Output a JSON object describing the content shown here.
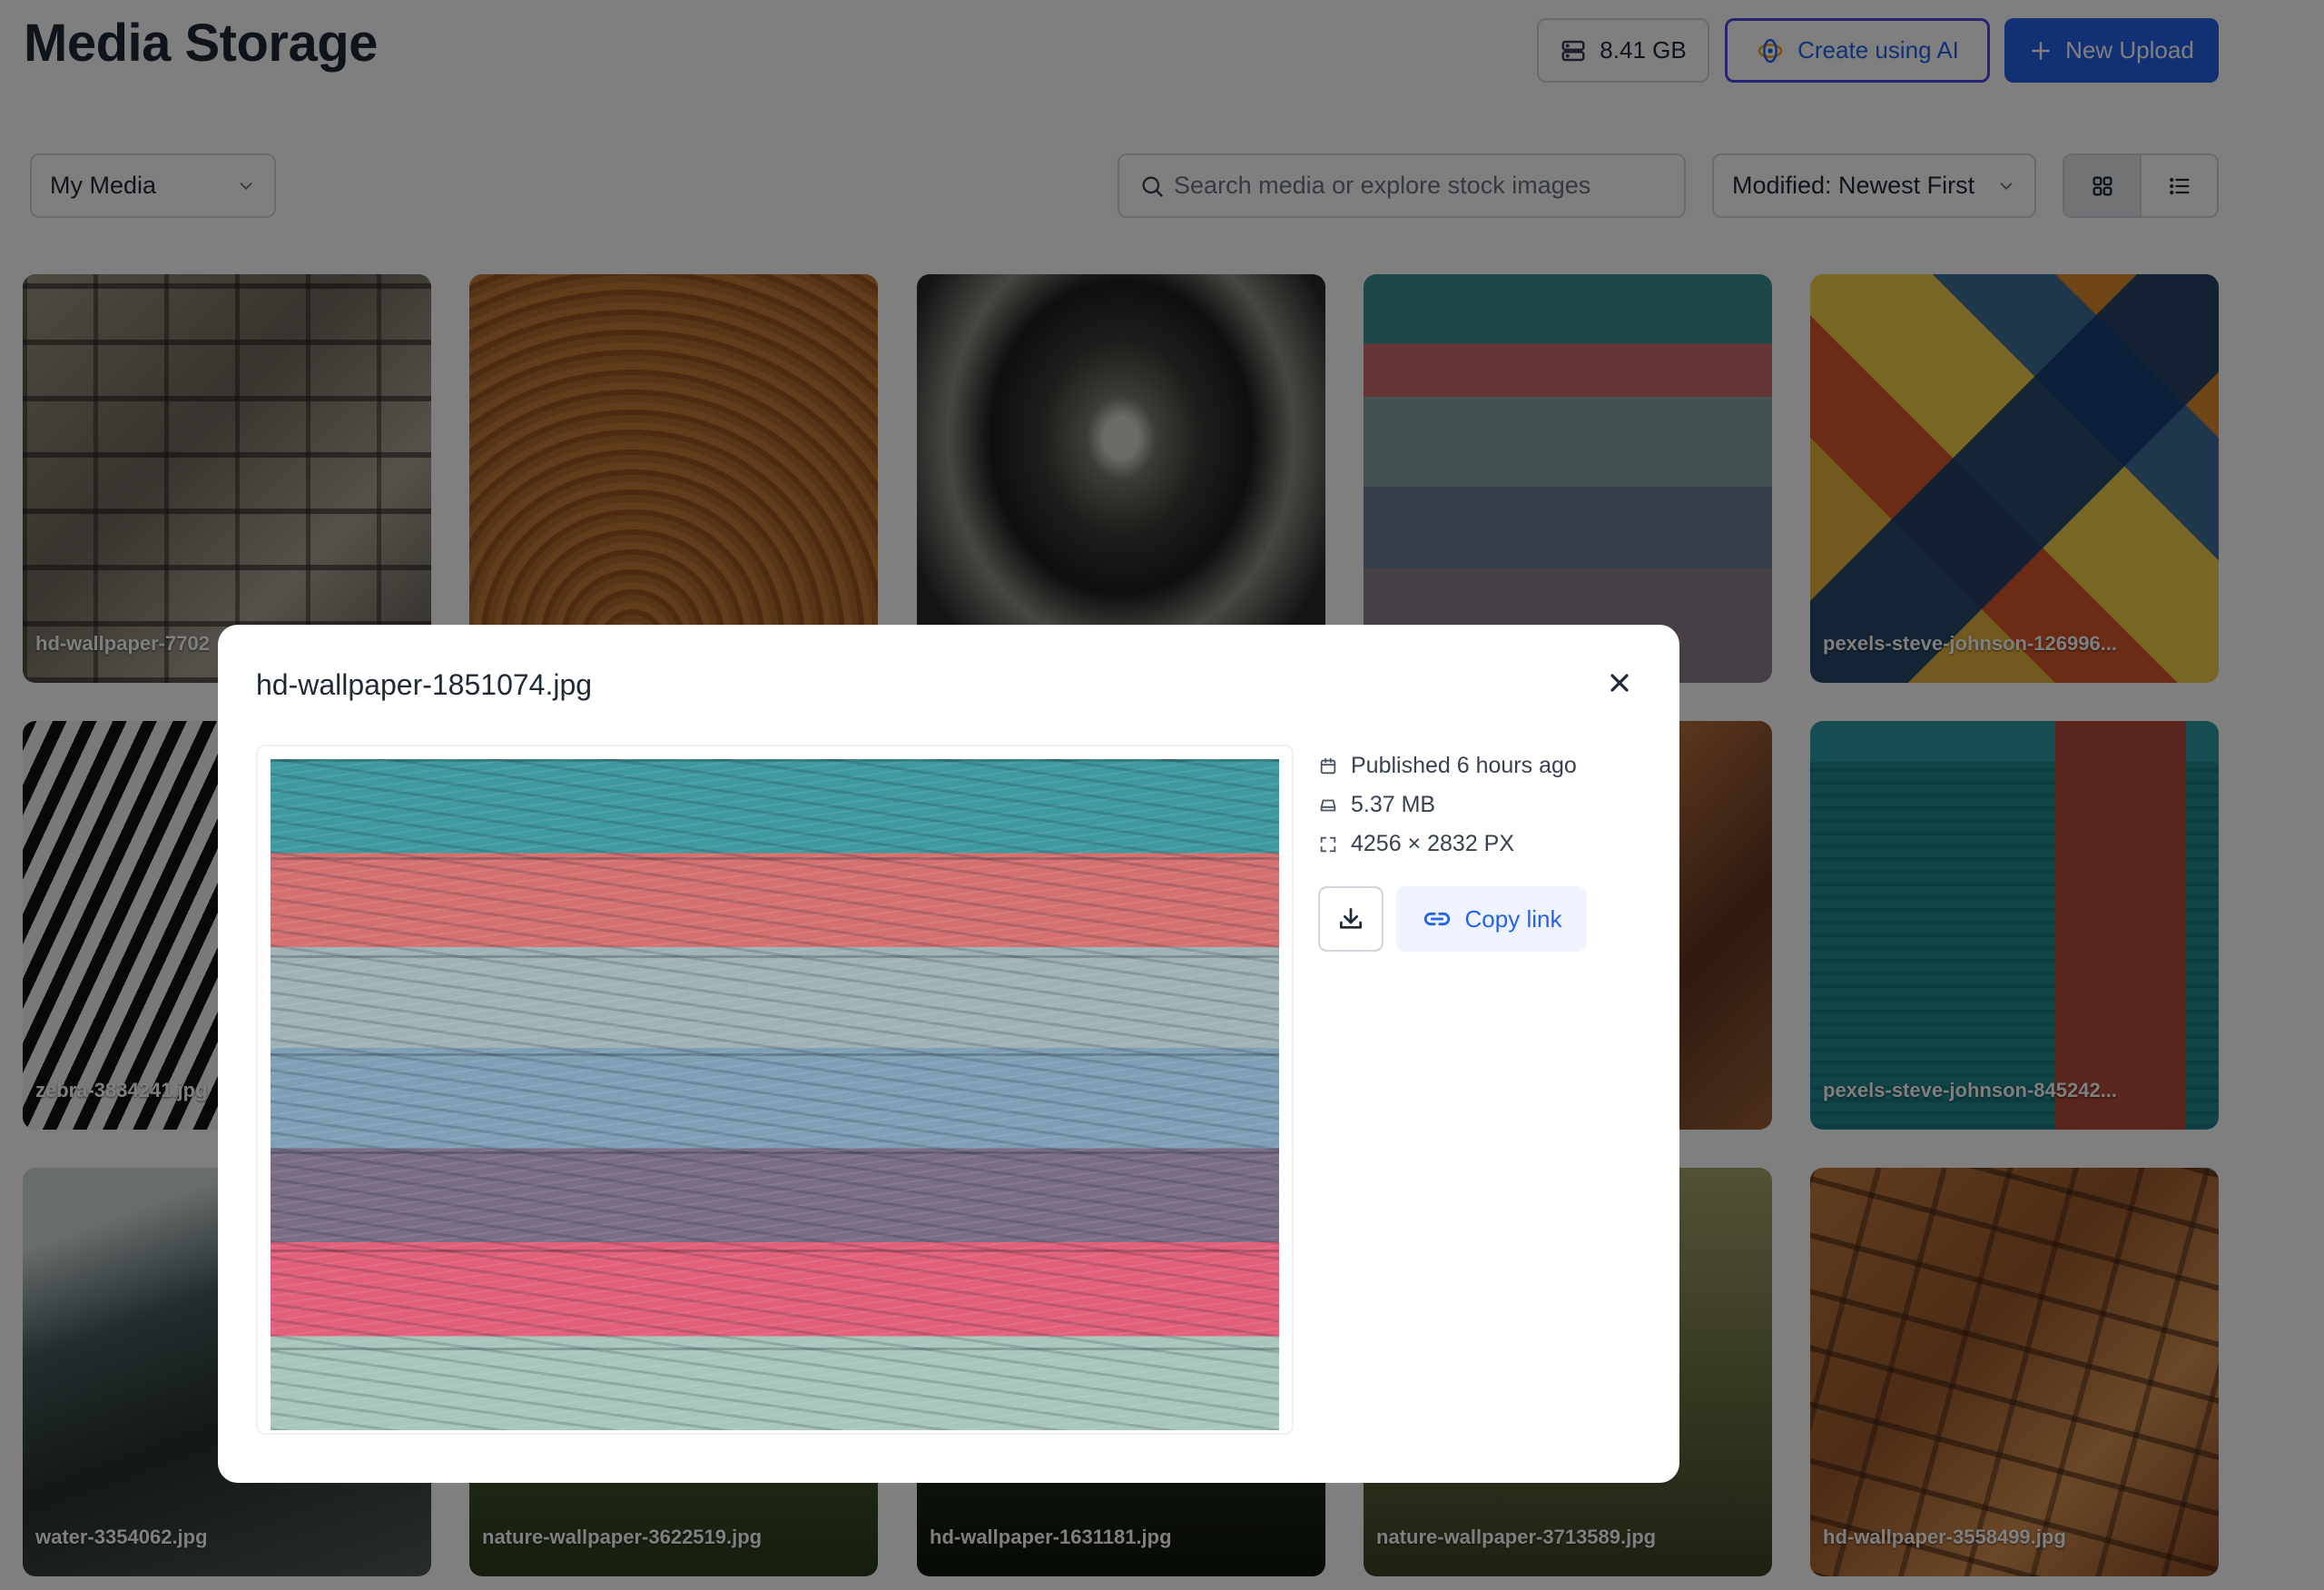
{
  "header": {
    "title": "Media Storage",
    "storage_used": "8.41 GB",
    "ai_button_label": "Create using AI",
    "upload_button_label": "New Upload"
  },
  "toolbar": {
    "source_select": "My Media",
    "search_placeholder": "Search media or explore stock images",
    "sort_select": "Modified: Newest First",
    "view_modes": [
      "grid-icon",
      "list-icon"
    ],
    "active_view": "grid"
  },
  "grid": {
    "tiles": [
      {
        "label": "hd-wallpaper-7702",
        "style": "stone"
      },
      {
        "label": "",
        "style": "wood"
      },
      {
        "label": "",
        "style": "tunnel"
      },
      {
        "label": "",
        "style": "planks"
      },
      {
        "label": "pexels-steve-johnson-126996...",
        "style": "abstract"
      },
      {
        "label": "zebra-3834241.jpg",
        "style": "zebra"
      },
      {
        "label": "",
        "style": "tools"
      },
      {
        "label": "pexels-steve-johnson-845242...",
        "style": "teal"
      },
      {
        "label": "water-3354062.jpg",
        "style": "water"
      },
      {
        "label": "nature-wallpaper-3622519.jpg",
        "style": "nature1"
      },
      {
        "label": "hd-wallpaper-1631181.jpg",
        "style": "hd3"
      },
      {
        "label": "nature-wallpaper-3713589.jpg",
        "style": "nature2"
      },
      {
        "label": "hd-wallpaper-3558499.jpg",
        "style": "rocks"
      }
    ]
  },
  "modal": {
    "title": "hd-wallpaper-1851074.jpg",
    "published": "Published 6 hours ago",
    "size": "5.37 MB",
    "dimensions": "4256 × 2832 PX",
    "copy_link_label": "Copy link"
  },
  "colors": {
    "accent": "#2563eb",
    "ai_border": "#4f46e5",
    "overlay": "rgba(0,0,0,0.5)"
  }
}
